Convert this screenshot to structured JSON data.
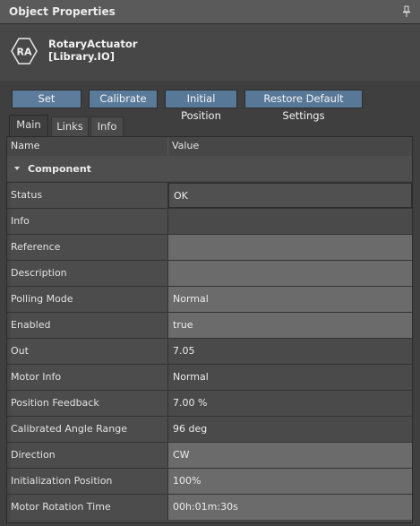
{
  "panel": {
    "title": "Object Properties",
    "pin_icon": "pin-icon"
  },
  "object": {
    "logo_text": "RA",
    "name_line1": "RotaryActuator",
    "name_line2": "[Library.IO]"
  },
  "toolbar": {
    "set": "Set",
    "calibrate": "Calibrate",
    "initial_position": "Initial Position",
    "restore": "Restore Default Settings"
  },
  "tabs": [
    "Main",
    "Links",
    "Info"
  ],
  "grid": {
    "col_name": "Name",
    "col_value": "Value",
    "section": "Component",
    "rows": [
      {
        "name": "Status",
        "value": "OK"
      },
      {
        "name": "Info",
        "value": ""
      },
      {
        "name": "Reference",
        "value": ""
      },
      {
        "name": "Description",
        "value": ""
      },
      {
        "name": "Polling Mode",
        "value": "Normal"
      },
      {
        "name": "Enabled",
        "value": "true"
      },
      {
        "name": "Out",
        "value": "7.05"
      },
      {
        "name": "Motor Info",
        "value": "Normal"
      },
      {
        "name": "Position Feedback",
        "value": "7.00 %"
      },
      {
        "name": "Calibrated Angle Range",
        "value": "96 deg"
      },
      {
        "name": "Direction",
        "value": "CW"
      },
      {
        "name": "Initialization Position",
        "value": "100%"
      },
      {
        "name": "Motor Rotation Time",
        "value": "00h:01m:30s"
      }
    ]
  },
  "colors": {
    "button": "#587898",
    "background": "#3f3f3f",
    "editable_cell": "#6b6b6b"
  }
}
